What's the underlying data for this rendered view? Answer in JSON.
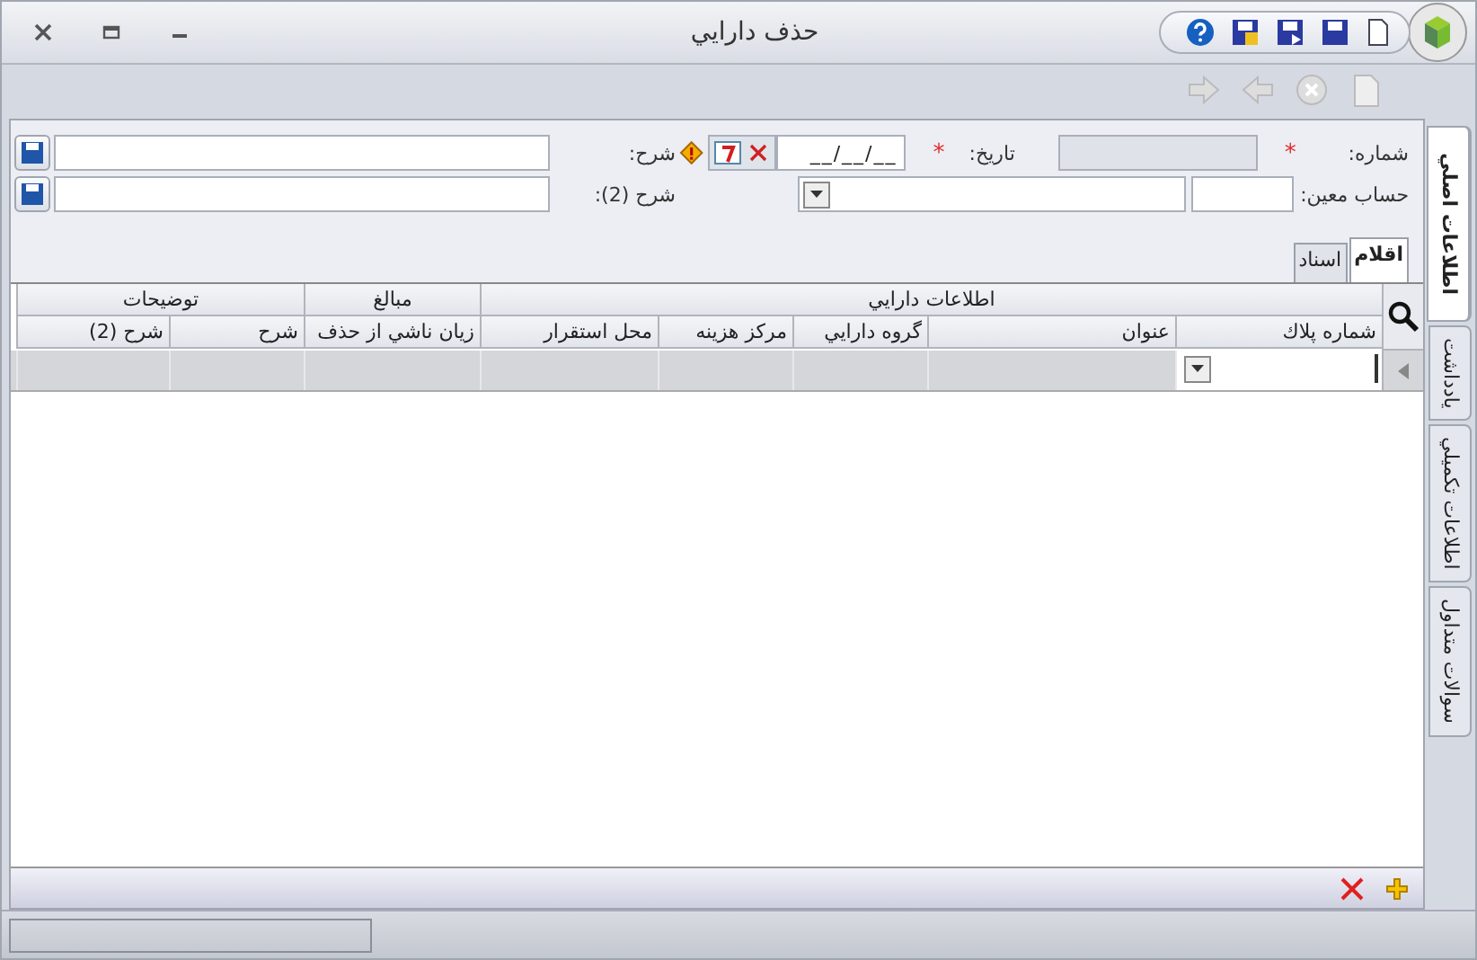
{
  "window": {
    "title": "حذف دارايي"
  },
  "side_tabs": [
    {
      "label": "اطلاعات اصلي",
      "selected": true
    },
    {
      "label": "يادداشت",
      "selected": false
    },
    {
      "label": "اطلاعات تكميلي",
      "selected": false
    },
    {
      "label": "سوالات متداول",
      "selected": false
    }
  ],
  "form": {
    "number": {
      "label": "شماره:",
      "required_mark": "*",
      "disabled": true
    },
    "date": {
      "label": "تاريخ:",
      "required_mark": "*",
      "value": "__/__/__"
    },
    "description": {
      "label": "شرح:"
    },
    "account": {
      "label": "حساب معين:"
    },
    "description2": {
      "label": "شرح (2):"
    }
  },
  "tabs": [
    {
      "label": "اقلام",
      "selected": true
    },
    {
      "label": "اسناد",
      "selected": false
    }
  ],
  "grid": {
    "groups": [
      {
        "label": "اطلاعات دارايي",
        "columns": [
          "شماره پلاك",
          "عنوان",
          "گروه دارايي",
          "مركز هزينه",
          "محل استقرار"
        ]
      },
      {
        "label": "مبالغ",
        "columns": [
          "زيان ناشي از حذف"
        ]
      },
      {
        "label": "توضيحات",
        "columns": [
          "شرح",
          "شرح (2)"
        ]
      }
    ]
  }
}
